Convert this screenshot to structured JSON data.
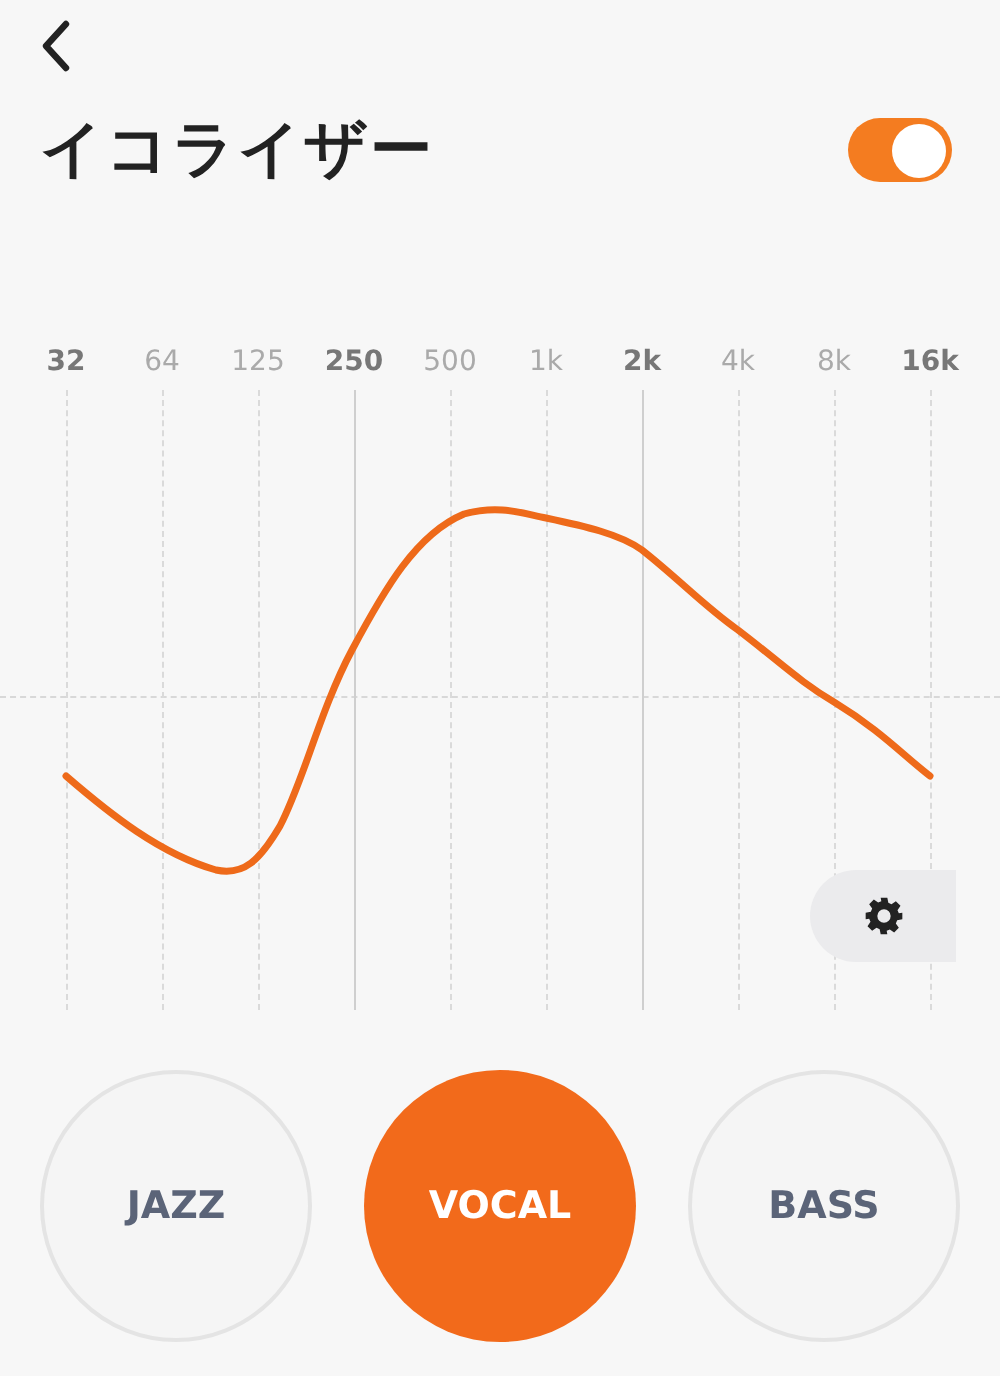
{
  "header": {
    "title": "イコライザー",
    "enabled": true
  },
  "bands": [
    {
      "label": "32",
      "major": true,
      "solid_line": false
    },
    {
      "label": "64",
      "major": false,
      "solid_line": false
    },
    {
      "label": "125",
      "major": false,
      "solid_line": false
    },
    {
      "label": "250",
      "major": true,
      "solid_line": true
    },
    {
      "label": "500",
      "major": false,
      "solid_line": false
    },
    {
      "label": "1k",
      "major": false,
      "solid_line": false
    },
    {
      "label": "2k",
      "major": true,
      "solid_line": true
    },
    {
      "label": "4k",
      "major": false,
      "solid_line": false
    },
    {
      "label": "8k",
      "major": false,
      "solid_line": false
    },
    {
      "label": "16k",
      "major": true,
      "solid_line": false
    }
  ],
  "presets": [
    {
      "label": "JAZZ",
      "selected": false
    },
    {
      "label": "VOCAL",
      "selected": true
    },
    {
      "label": "BASS",
      "selected": false
    }
  ]
}
